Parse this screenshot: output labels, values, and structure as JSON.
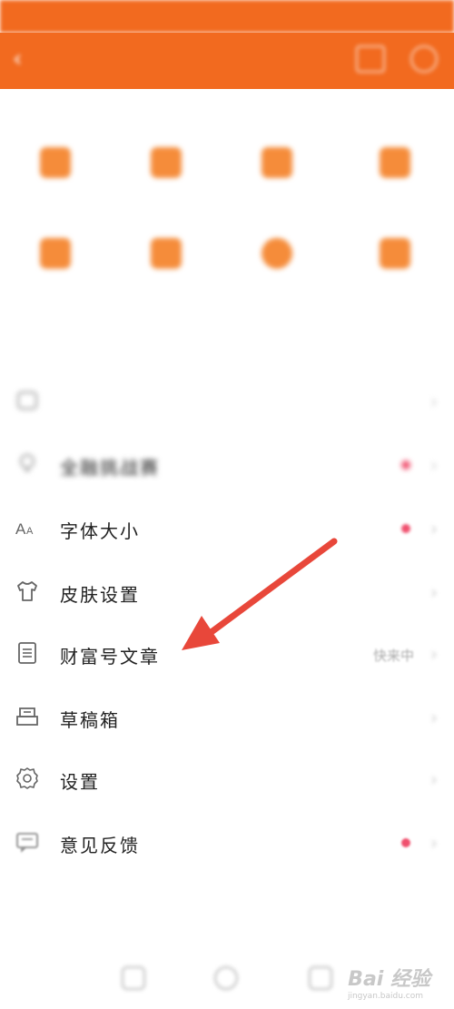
{
  "status_bar": {
    "left": "",
    "right": ""
  },
  "nav": {
    "back_label": "‹",
    "title": ""
  },
  "services": {
    "title": "",
    "items": [
      {
        "label": ""
      },
      {
        "label": ""
      },
      {
        "label": ""
      },
      {
        "label": ""
      },
      {
        "label": ""
      },
      {
        "label": ""
      },
      {
        "label": ""
      },
      {
        "label": ""
      }
    ]
  },
  "common": {
    "title": ""
  },
  "list": [
    {
      "label": "",
      "value": "",
      "icon": "layers-icon",
      "dot": false
    },
    {
      "label": "全融挑战赛",
      "value": "",
      "icon": "bulb-icon",
      "dot": true
    },
    {
      "label": "字体大小",
      "value": "",
      "icon": "font-size-icon",
      "dot": true
    },
    {
      "label": "皮肤设置",
      "value": "",
      "icon": "shirt-icon",
      "dot": false
    },
    {
      "label": "财富号文章",
      "value": "快来中",
      "icon": "document-icon",
      "dot": false
    },
    {
      "label": "草稿箱",
      "value": "",
      "icon": "drafts-icon",
      "dot": false
    },
    {
      "label": "设置",
      "value": "",
      "icon": "gear-icon",
      "dot": false
    },
    {
      "label": "意见反馈",
      "value": "",
      "icon": "feedback-icon",
      "dot": true
    }
  ],
  "logout_label": "",
  "watermark": {
    "brand": "Bai 经验",
    "url": "jingyan.baidu.com"
  },
  "colors": {
    "accent": "#f26a1f",
    "arrow": "#e8473a",
    "dot": "#f0506e"
  }
}
